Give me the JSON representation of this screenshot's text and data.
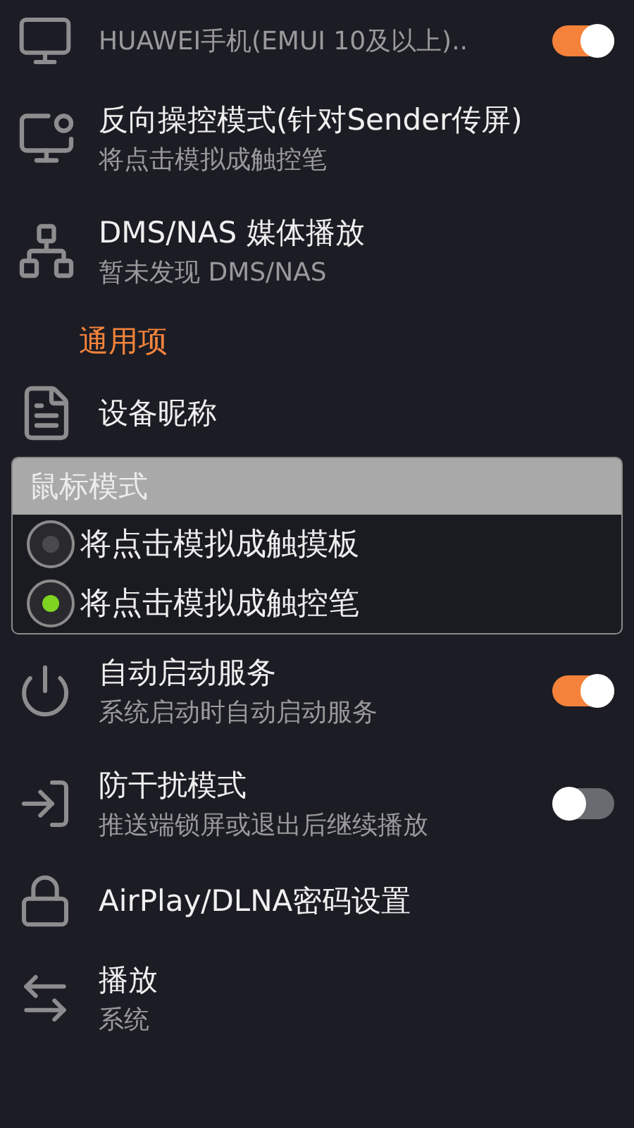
{
  "settings_above": [
    {
      "kind": "toggle",
      "subtitle": "HUAWEI手机(EMUI 10及以上)..",
      "on": true
    },
    {
      "kind": "entry",
      "title": "反向操控模式(针对Sender传屏)",
      "subtitle": "将点击模拟成触控笔"
    },
    {
      "kind": "entry",
      "title": "DMS/NAS 媒体播放",
      "subtitle": "暂未发现 DMS/NAS"
    },
    {
      "kind": "header",
      "title": "通用项"
    },
    {
      "kind": "entry",
      "title": "设备昵称"
    }
  ],
  "dialog": {
    "title": "鼠标模式",
    "options": [
      {
        "label": "将点击模拟成触摸板",
        "selected": false
      },
      {
        "label": "将点击模拟成触控笔",
        "selected": true
      }
    ]
  },
  "settings_below": [
    {
      "kind": "toggle",
      "title": "自动启动服务",
      "subtitle": "系统启动时自动启动服务",
      "on": true
    },
    {
      "kind": "toggle",
      "title": "防干扰模式",
      "subtitle": "推送端锁屏或退出后继续播放",
      "on": false
    },
    {
      "kind": "entry",
      "title": "AirPlay/DLNA密码设置"
    },
    {
      "kind": "entry",
      "title": "播放",
      "subtitle": "系统"
    }
  ]
}
